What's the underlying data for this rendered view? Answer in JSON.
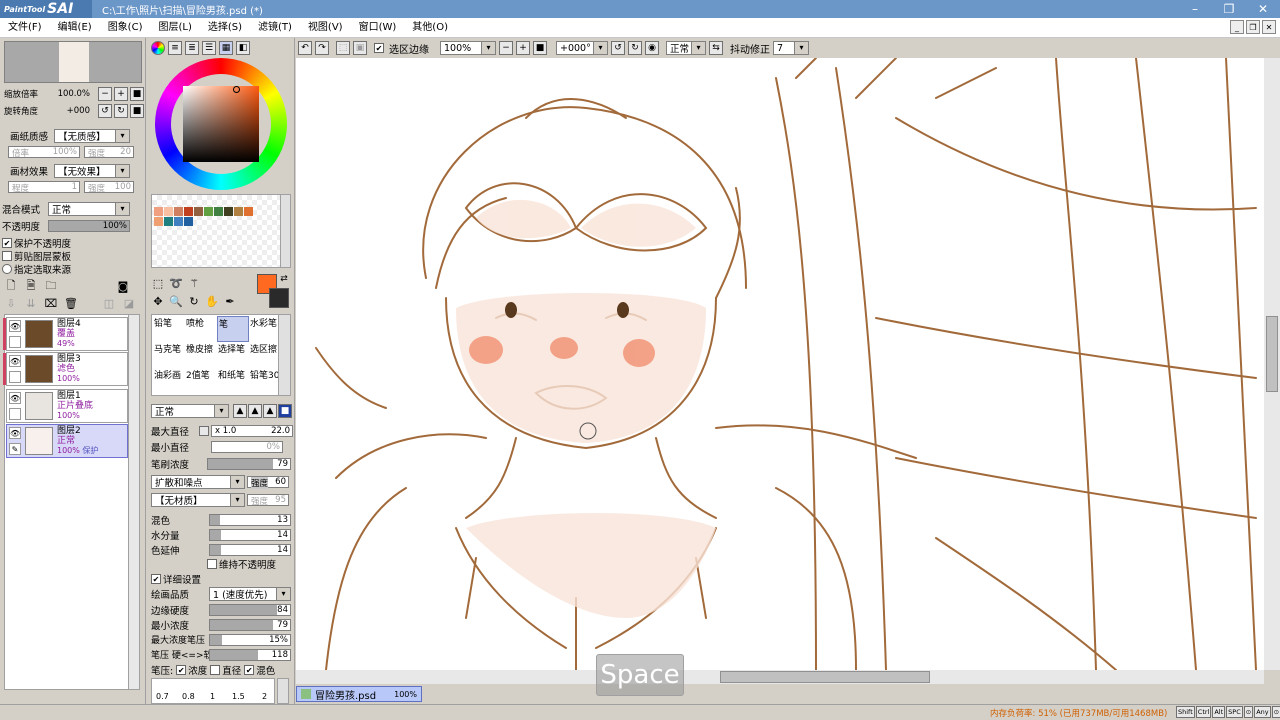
{
  "window": {
    "app_logo_small": "PaintTool",
    "app_logo_big": "SAI",
    "title": "C:\\工作\\照片\\扫描\\冒险男孩.psd (*)",
    "min": "–",
    "max": "❐",
    "close": "✕"
  },
  "menu": [
    "文件(F)",
    "编辑(E)",
    "图象(C)",
    "图层(L)",
    "选择(S)",
    "滤镜(T)",
    "视图(V)",
    "窗口(W)",
    "其他(O)"
  ],
  "navigator": {
    "zoom_label": "缩放倍率",
    "zoom_value": "100.0%",
    "rotate_label": "旋转角度",
    "rotate_value": "+000"
  },
  "paper": {
    "texture_label": "画纸质感",
    "texture_value": "【无质感】",
    "scale_label": "倍率",
    "scale_value": "100%",
    "strength_label": "强度",
    "strength_value": "20",
    "effect_label": "画材效果",
    "effect_value": "【无效果】",
    "degree_label": "程度",
    "degree_value": "1",
    "effect_strength_label": "强度",
    "effect_strength_value": "100"
  },
  "blend": {
    "mode_label": "混合模式",
    "mode_value": "正常",
    "opacity_label": "不透明度",
    "opacity_value": "100%",
    "opacity_fraction": 1.0,
    "check1": "保护不透明度",
    "check2": "剪贴图层蒙板",
    "check3": "指定选取来源"
  },
  "layers": [
    {
      "name": "图层4",
      "mode": "覆盖",
      "opacity": "49%",
      "thumb": "#6b4a2a",
      "marked": true,
      "active": false
    },
    {
      "name": "图层3",
      "mode": "滤色",
      "opacity": "100%",
      "thumb": "#6b4a2a",
      "marked": true,
      "active": false
    },
    {
      "name": "图层1",
      "mode": "正片叠底",
      "opacity": "100%",
      "thumb": "#e8e4e0",
      "marked": false,
      "active": false
    },
    {
      "name": "图层2",
      "mode": "正常",
      "opacity": "100%",
      "extra": "保护",
      "thumb": "#f8f0ec",
      "marked": false,
      "active": true
    }
  ],
  "colors": {
    "primary": "#ff6a20",
    "secondary": "#2a2a2a",
    "swatches": [
      "#f0a080",
      "#f8c0a0",
      "#d08060",
      "#c04020",
      "#906040",
      "#60a040",
      "#408040",
      "#404020",
      "#b08040",
      "#e07030",
      "#f0a070",
      "#208080",
      "#4080c0",
      "#2060a0"
    ]
  },
  "brushes": [
    {
      "label": "铅笔",
      "on": false
    },
    {
      "label": "喷枪",
      "on": false
    },
    {
      "label": "笔",
      "on": true
    },
    {
      "label": "水彩笔",
      "on": false
    },
    {
      "label": "马克笔",
      "on": false
    },
    {
      "label": "橡皮擦",
      "on": false
    },
    {
      "label": "选择笔",
      "on": false
    },
    {
      "label": "选区擦",
      "on": false
    },
    {
      "label": "油彩画",
      "on": false
    },
    {
      "label": "2值笔",
      "on": false
    },
    {
      "label": "和纸笔",
      "on": false
    },
    {
      "label": "铅笔30",
      "on": false
    }
  ],
  "brush_settings": {
    "mode_value": "正常",
    "max_size_label": "最大直径",
    "max_size_mult": "x 1.0",
    "max_size_value": "22.0",
    "min_size_label": "最小直径",
    "min_size_value": "0%",
    "density_label": "笔刷浓度",
    "density_value": "79",
    "density_fraction": 0.79,
    "shape_value": "扩散和噪点",
    "shape_strength_label": "强度",
    "shape_strength_value": "60",
    "texture_value": "【无材质】",
    "texture_strength_label": "强度",
    "texture_strength_value": "95",
    "blend_label": "混色",
    "blend_value": "13",
    "blend_fraction": 0.13,
    "water_label": "水分量",
    "water_value": "14",
    "water_fraction": 0.14,
    "persist_label": "色延伸",
    "persist_value": "14",
    "persist_fraction": 0.14,
    "keep_opacity_label": "维持不透明度",
    "detail_label": "详细设置",
    "quality_label": "绘画品质",
    "quality_value": "1 (速度优先)",
    "edge_label": "边缘硬度",
    "edge_value": "84",
    "edge_fraction": 0.84,
    "min_density_label": "最小浓度",
    "min_density_value": "79",
    "min_density_fraction": 0.79,
    "max_pressure_label": "最大浓度笔压",
    "max_pressure_value": "15%",
    "max_pressure_fraction": 0.15,
    "pressure_label": "笔压 硬<=>软",
    "pressure_value": "118",
    "pressure_fraction": 0.6,
    "pressure_opts_label": "笔压:",
    "opt_density": "浓度",
    "opt_size": "直径",
    "opt_blend": "混色",
    "presets": [
      "0.7",
      "0.8",
      "1",
      "1.5",
      "2"
    ]
  },
  "canvas_toolbar": {
    "selection_edge_label": "选区边缘",
    "zoom_value": "100%",
    "angle_value": "+000°",
    "mode_value": "正常",
    "stabilizer_label": "抖动修正",
    "stabilizer_value": "7"
  },
  "doc_tab": {
    "name": "冒险男孩.psd",
    "zoom": "100%"
  },
  "status": {
    "memory": "内存负荷率: 51% (已用737MB/可用1468MB)",
    "keys": [
      "Shift",
      "Ctrl",
      "Alt",
      "SPC",
      "⊙",
      "Any",
      "⊙"
    ]
  },
  "overlay": {
    "space": "Space"
  }
}
